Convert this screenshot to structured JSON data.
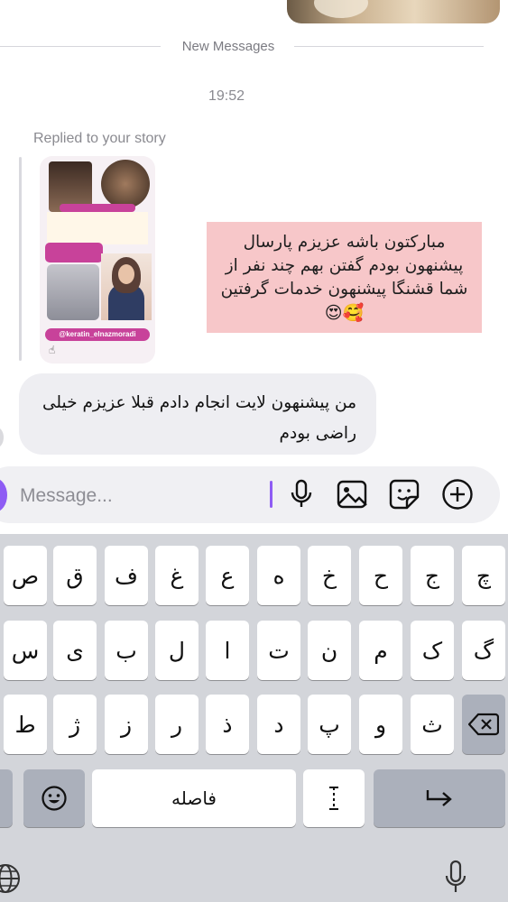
{
  "divider": {
    "text": "New Messages"
  },
  "timestamp": "19:52",
  "reply": {
    "label": "Replied to your story",
    "story_handle": "@keratin_elnazmoradi"
  },
  "story_message": {
    "text": "مبارکتون باشه عزیزم پارسال پیشنهون بودم گفتن بهم چند نفر از شما قشنگا پیشنهون خدمات گرفتین",
    "emojis": "🥰😍"
  },
  "reply_message": {
    "text": "من پیشنهون لایت انجام دادم قبلا عزیزم خیلی راضی بودم"
  },
  "composer": {
    "placeholder": "Message..."
  },
  "composer_icons": [
    "microphone-icon",
    "gallery-icon",
    "sticker-icon",
    "add-icon"
  ],
  "keyboard": {
    "row1": [
      "چ",
      "ج",
      "ح",
      "خ",
      "ه",
      "ع",
      "غ",
      "ف",
      "ق",
      "ص"
    ],
    "row2": [
      "گ",
      "ک",
      "م",
      "ن",
      "ت",
      "ا",
      "ل",
      "ب",
      "ی",
      "س"
    ],
    "row3": [
      "ث",
      "و",
      "پ",
      "د",
      "ذ",
      "ر",
      "ز",
      "ژ",
      "ط"
    ],
    "space_label": "فاصله"
  },
  "colors": {
    "accent": "#8e5cf4",
    "note_bg": "#f7c7c9",
    "bubble_bg": "#eeeef2",
    "keyboard_bg": "#d3d5da"
  }
}
